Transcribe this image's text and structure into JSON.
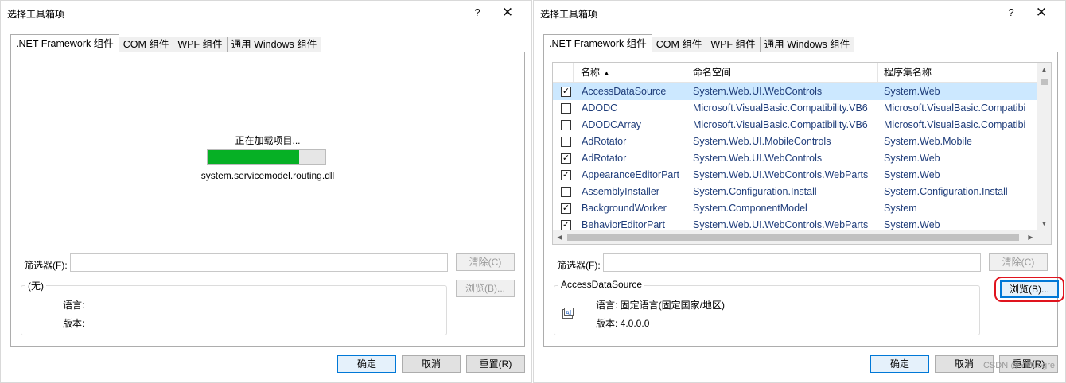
{
  "left": {
    "title": "选择工具箱项",
    "help_glyph": "?",
    "close_glyph": "✕",
    "tabs": [
      ".NET Framework 组件",
      "COM 组件",
      "WPF 组件",
      "通用 Windows 组件"
    ],
    "loading": {
      "text": "正在加载项目...",
      "file": "system.servicemodel.routing.dll",
      "progress": 0.78
    },
    "filter_label": "筛选器(F):",
    "filter_value": "",
    "clear_button": "清除(C)",
    "browse_button": "浏览(B)...",
    "group_title": "(无)",
    "language_label": "语言:",
    "version_label": "版本:",
    "ok_button": "确定",
    "cancel_button": "取消",
    "reset_button": "重置(R)"
  },
  "right": {
    "title": "选择工具箱项",
    "help_glyph": "?",
    "close_glyph": "✕",
    "tabs": [
      ".NET Framework 组件",
      "COM 组件",
      "WPF 组件",
      "通用 Windows 组件"
    ],
    "columns": [
      "名称",
      "命名空间",
      "程序集名称"
    ],
    "rows": [
      {
        "checked": true,
        "name": "AccessDataSource",
        "namespace": "System.Web.UI.WebControls",
        "assembly": "System.Web",
        "selected": true
      },
      {
        "checked": false,
        "name": "ADODC",
        "namespace": "Microsoft.VisualBasic.Compatibility.VB6",
        "assembly": "Microsoft.VisualBasic.Compatibi"
      },
      {
        "checked": false,
        "name": "ADODCArray",
        "namespace": "Microsoft.VisualBasic.Compatibility.VB6",
        "assembly": "Microsoft.VisualBasic.Compatibi"
      },
      {
        "checked": false,
        "name": "AdRotator",
        "namespace": "System.Web.UI.MobileControls",
        "assembly": "System.Web.Mobile"
      },
      {
        "checked": true,
        "name": "AdRotator",
        "namespace": "System.Web.UI.WebControls",
        "assembly": "System.Web"
      },
      {
        "checked": true,
        "name": "AppearanceEditorPart",
        "namespace": "System.Web.UI.WebControls.WebParts",
        "assembly": "System.Web"
      },
      {
        "checked": false,
        "name": "AssemblyInstaller",
        "namespace": "System.Configuration.Install",
        "assembly": "System.Configuration.Install"
      },
      {
        "checked": true,
        "name": "BackgroundWorker",
        "namespace": "System.ComponentModel",
        "assembly": "System"
      },
      {
        "checked": true,
        "name": "BehaviorEditorPart",
        "namespace": "System.Web.UI.WebControls.WebParts",
        "assembly": "System.Web"
      }
    ],
    "filter_label": "筛选器(F):",
    "filter_value": "",
    "clear_button": "清除(C)",
    "browse_button": "浏览(B)...",
    "group_title": "AccessDataSource",
    "language_line": "语言:  固定语言(固定国家/地区)",
    "version_line": "版本:  4.0.0.0",
    "ok_button": "确定",
    "cancel_button": "取消",
    "reset_button": "重置(R)",
    "check_glyph": "✓",
    "sort_glyph": "▲"
  },
  "watermark": "CSDN @YMLogre",
  "colors": {
    "progress": "#06b025",
    "selection": "#cce8ff",
    "highlight_ring": "#e0141e",
    "focus": "#0078d7"
  }
}
